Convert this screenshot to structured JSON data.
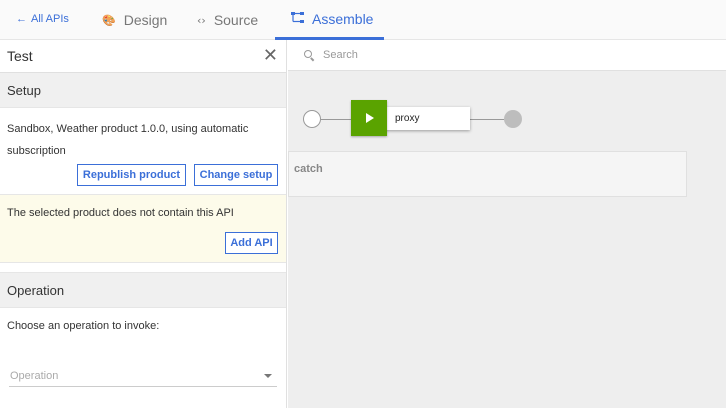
{
  "nav": {
    "back_arrow": "←",
    "back_label": "All APIs",
    "tabs": [
      {
        "label": "Design",
        "icon": "palette-icon",
        "glyph": "🎨"
      },
      {
        "label": "Source",
        "icon": "code-icon",
        "glyph": "‹›"
      },
      {
        "label": "Assemble",
        "icon": "assemble-icon",
        "glyph": "⛓"
      }
    ],
    "accent_color": "#3b6fd8"
  },
  "test_panel": {
    "title": "Test",
    "close_glyph": "✕",
    "setup": {
      "heading": "Setup",
      "description": "Sandbox, Weather product 1.0.0, using automatic subscription",
      "republish_label": "Republish product",
      "change_setup_label": "Change setup"
    },
    "warning": {
      "message": "The selected product does not contain this API",
      "add_api_label": "Add API"
    },
    "operation": {
      "heading": "Operation",
      "prompt": "Choose an operation to invoke:",
      "select_placeholder": "Operation"
    }
  },
  "canvas": {
    "search_placeholder": "Search",
    "policy_label": "proxy",
    "policy_color": "#5aa300",
    "catch_label": "catch"
  }
}
